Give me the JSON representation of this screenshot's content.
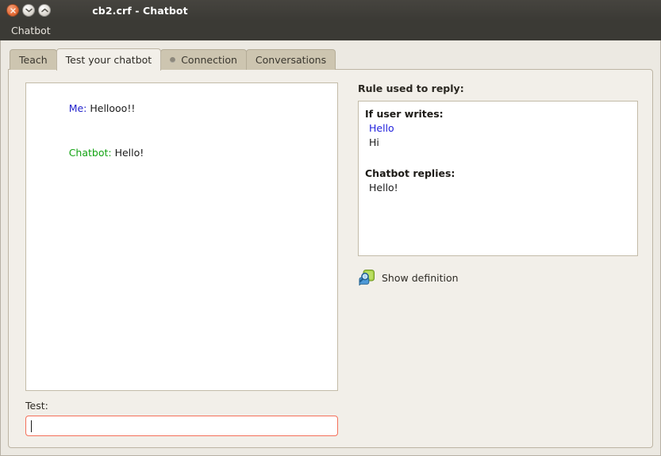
{
  "window": {
    "title": "cb2.crf - Chatbot",
    "controls": [
      {
        "name": "close-button",
        "glyph": "×"
      },
      {
        "name": "minimize-button",
        "glyph": "⌄"
      },
      {
        "name": "maximize-button",
        "glyph": "⌃"
      }
    ]
  },
  "menubar": {
    "items": [
      {
        "label": "Chatbot"
      }
    ]
  },
  "tabs": [
    {
      "label": "Teach",
      "active": false,
      "has_dot": false
    },
    {
      "label": "Test your chatbot",
      "active": true,
      "has_dot": false
    },
    {
      "label": "Connection",
      "active": false,
      "has_dot": true
    },
    {
      "label": "Conversations",
      "active": false,
      "has_dot": false
    }
  ],
  "chat": {
    "lines": [
      {
        "speaker": "Me:",
        "speaker_color": "#2222cc",
        "text": " Hellooo!!"
      },
      {
        "speaker": "Chatbot:",
        "speaker_color": "#13a313",
        "text": " Hello!"
      }
    ]
  },
  "test": {
    "label": "Test:",
    "value": "",
    "placeholder": ""
  },
  "rule": {
    "heading": "Rule used to reply:",
    "if_user_writes_title": "If user writes:",
    "if_user_writes": [
      {
        "text": "Hello",
        "matched": true
      },
      {
        "text": "Hi",
        "matched": false
      }
    ],
    "chatbot_replies_title": "Chatbot replies:",
    "chatbot_replies": [
      {
        "text": "Hello!"
      }
    ]
  },
  "show_definition": {
    "label": "Show definition",
    "icon": "magnifier-definition-icon"
  },
  "colors": {
    "titlebar": "#3b3a35",
    "window_bg": "#ded9d0",
    "panel_bg": "#f2efe9",
    "tab_inactive": "#cdc5b0",
    "focus_border": "#f4705a",
    "me_color": "#2222cc",
    "bot_color": "#13a313",
    "matched_color": "#2222dd"
  }
}
